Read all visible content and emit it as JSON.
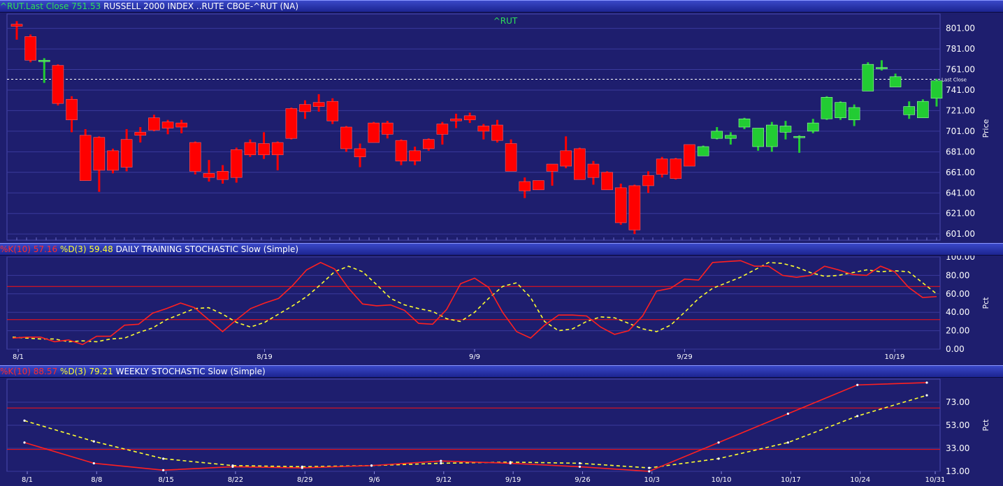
{
  "header": {
    "price_prefix": "^RUT.Last Close",
    "price_value": "751.53",
    "price_title": "RUSSELL 2000 INDEX ..RUTE CBOE-^RUT (NA)",
    "daily_k_label": "%K(10)",
    "daily_k_value": "57.16",
    "daily_d_label": "%D(3)",
    "daily_d_value": "59.48",
    "daily_title": "DAILY TRAINING STOCHASTIC Slow (Simple)",
    "weekly_k_label": "%K(10)",
    "weekly_k_value": "88.57",
    "weekly_d_label": "%D(3)",
    "weekly_d_value": "79.21",
    "weekly_title": "WEEKLY STOCHASTIC Slow (Simple)"
  },
  "colors": {
    "background": "#1e1e6e",
    "grid": "#3a3a9c",
    "up": "#22cc33",
    "down": "#ff0000",
    "k_line": "#ff2020",
    "d_line": "#ffff30",
    "text": "#ffffff",
    "symbol_label": "#2ee05a"
  },
  "chart_data": [
    {
      "type": "candlestick",
      "title": "^RUT",
      "ylabel": "Price",
      "ylim": [
        595,
        815
      ],
      "yticks": [
        "801.00",
        "781.00",
        "761.00",
        "741.00",
        "721.00",
        "701.00",
        "681.00",
        "661.00",
        "641.00",
        "621.00",
        "601.00"
      ],
      "last_close": 751.53,
      "last_close_label": "Last Close",
      "candles": [
        [
          805,
          803,
          808,
          790
        ],
        [
          793,
          770,
          795,
          768
        ],
        [
          770,
          770,
          772,
          748
        ],
        [
          765,
          728,
          766,
          726
        ],
        [
          732,
          712,
          735,
          700
        ],
        [
          697,
          653,
          703,
          653
        ],
        [
          695,
          663,
          696,
          642
        ],
        [
          682,
          663,
          684,
          660
        ],
        [
          693,
          666,
          703,
          662
        ],
        [
          700,
          697,
          705,
          690
        ],
        [
          714,
          702,
          717,
          701
        ],
        [
          710,
          704,
          712,
          698
        ],
        [
          709,
          705,
          712,
          699
        ],
        [
          690,
          662,
          691,
          659
        ],
        [
          660,
          656,
          673,
          652
        ],
        [
          662,
          654,
          668,
          650
        ],
        [
          683,
          656,
          685,
          651
        ],
        [
          690,
          678,
          693,
          676
        ],
        [
          689,
          678,
          700,
          674
        ],
        [
          690,
          678,
          691,
          663
        ],
        [
          723,
          694,
          724,
          693
        ],
        [
          727,
          720,
          731,
          713
        ],
        [
          729,
          725,
          737,
          720
        ],
        [
          730,
          711,
          733,
          708
        ],
        [
          705,
          684,
          706,
          681
        ],
        [
          684,
          676,
          689,
          666
        ],
        [
          709,
          690,
          710,
          690
        ],
        [
          709,
          698,
          711,
          694
        ],
        [
          692,
          672,
          693,
          668
        ],
        [
          682,
          672,
          686,
          668
        ],
        [
          693,
          684,
          694,
          682
        ],
        [
          708,
          698,
          710,
          688
        ],
        [
          713,
          711,
          718,
          704
        ],
        [
          716,
          712,
          719,
          709
        ],
        [
          706,
          701,
          708,
          693
        ],
        [
          707,
          692,
          712,
          690
        ],
        [
          689,
          662,
          693,
          662
        ],
        [
          652,
          643,
          656,
          636
        ],
        [
          653,
          644,
          653,
          644
        ],
        [
          669,
          662,
          669,
          648
        ],
        [
          682,
          667,
          696,
          665
        ],
        [
          684,
          654,
          685,
          654
        ],
        [
          669,
          656,
          672,
          649
        ],
        [
          661,
          644,
          662,
          644
        ],
        [
          646,
          612,
          650,
          610
        ],
        [
          648,
          605,
          649,
          601
        ],
        [
          658,
          648,
          662,
          641
        ],
        [
          674,
          659,
          676,
          656
        ],
        [
          674,
          655,
          675,
          654
        ],
        [
          688,
          667,
          688,
          667
        ],
        [
          677,
          686,
          687,
          677
        ],
        [
          694,
          701,
          705,
          693
        ],
        [
          694,
          697,
          700,
          688
        ],
        [
          705,
          713,
          714,
          703
        ],
        [
          686,
          704,
          704,
          682
        ],
        [
          686,
          707,
          710,
          681
        ],
        [
          700,
          706,
          711,
          693
        ],
        [
          696,
          696,
          697,
          680
        ],
        [
          701,
          709,
          713,
          699
        ],
        [
          713,
          734,
          735,
          712
        ],
        [
          714,
          729,
          730,
          712
        ],
        [
          712,
          724,
          727,
          706
        ],
        [
          740,
          766,
          768,
          740
        ],
        [
          763,
          763,
          770,
          760
        ],
        [
          744,
          754,
          757,
          744
        ],
        [
          717,
          725,
          730,
          713
        ],
        [
          714,
          730,
          732,
          714
        ],
        [
          733,
          750,
          752,
          725
        ]
      ],
      "xlabels": []
    },
    {
      "type": "line",
      "title": "DAILY TRAINING STOCHASTIC Slow (Simple)",
      "ylabel": "Pct",
      "ylim": [
        0,
        100
      ],
      "yticks": [
        "100.00",
        "80.00",
        "60.00",
        "40.00",
        "20.00",
        "0.00"
      ],
      "ref_lines": [
        68,
        32
      ],
      "categories": [
        "8/1",
        "8/19",
        "9/9",
        "9/29",
        "10/19"
      ],
      "series": [
        {
          "name": "%K(10)",
          "values": [
            12,
            13,
            13,
            8,
            10,
            5,
            14,
            14,
            26,
            27,
            39,
            44,
            50,
            45,
            32,
            19,
            32,
            44,
            50,
            55,
            69,
            86,
            94,
            87,
            66,
            49,
            47,
            48,
            42,
            28,
            27,
            43,
            71,
            77,
            67,
            40,
            19,
            12,
            26,
            37,
            37,
            36,
            24,
            16,
            20,
            36,
            63,
            66,
            76,
            75,
            94,
            95,
            96,
            90,
            90,
            80,
            78,
            80,
            90,
            86,
            81,
            80,
            90,
            84,
            67,
            56,
            57
          ]
        },
        {
          "name": "%D(3)",
          "values": [
            13,
            12,
            11,
            11,
            8,
            9,
            8,
            11,
            12,
            18,
            23,
            32,
            38,
            44,
            45,
            38,
            29,
            24,
            29,
            38,
            47,
            57,
            70,
            84,
            90,
            84,
            70,
            55,
            48,
            44,
            41,
            33,
            30,
            40,
            55,
            68,
            72,
            56,
            30,
            20,
            22,
            30,
            35,
            34,
            28,
            22,
            19,
            26,
            40,
            55,
            66,
            72,
            78,
            86,
            94,
            93,
            89,
            83,
            79,
            80,
            83,
            86,
            84,
            85,
            84,
            72,
            60
          ]
        }
      ]
    },
    {
      "type": "line",
      "title": "WEEKLY STOCHASTIC Slow (Simple)",
      "ylabel": "Pct",
      "ylim": [
        13,
        93
      ],
      "yticks": [
        "73.00",
        "53.00",
        "33.00",
        "13.00"
      ],
      "ref_lines": [
        68,
        32
      ],
      "categories": [
        "8/1",
        "8/8",
        "8/15",
        "8/22",
        "8/29",
        "9/6",
        "9/12",
        "9/19",
        "9/26",
        "10/3",
        "10/10",
        "10/17",
        "10/24",
        "10/31"
      ],
      "series": [
        {
          "name": "%K(10)",
          "values": [
            38,
            20,
            14,
            17,
            16,
            18,
            22,
            20,
            17,
            13,
            38,
            63,
            88,
            90
          ]
        },
        {
          "name": "%D(3)",
          "values": [
            57,
            39,
            24,
            18,
            17,
            18,
            20,
            21,
            20,
            16,
            24,
            38,
            61,
            79
          ]
        }
      ]
    }
  ]
}
